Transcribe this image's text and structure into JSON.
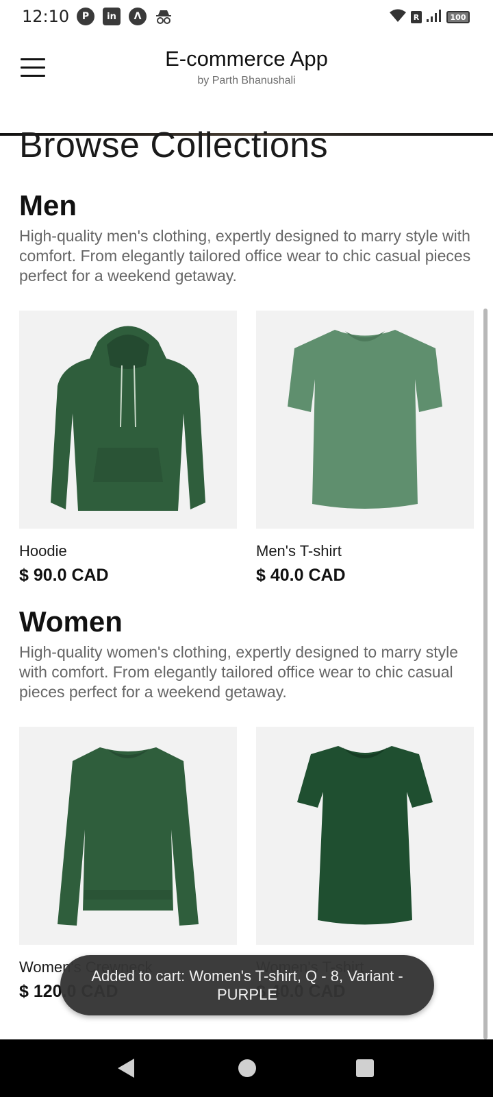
{
  "status_bar": {
    "time": "12:10",
    "notification_icons": [
      "pinterest-icon",
      "linkedin-icon",
      "arch-icon",
      "incognito-icon"
    ],
    "r_badge": "R",
    "battery": "100"
  },
  "app_bar": {
    "title": "E-commerce App",
    "subtitle": "by Parth Bhanushali"
  },
  "page": {
    "title": "Browse Collections"
  },
  "sections": [
    {
      "title": "Men",
      "description": "High-quality men's clothing, expertly designed to marry style with comfort. From elegantly tailored office wear to chic casual pieces perfect for a weekend getaway.",
      "products": [
        {
          "name": "Hoodie",
          "price": "$ 90.0 CAD",
          "image": "green-hoodie"
        },
        {
          "name": "Men's T-shirt",
          "price": "$ 40.0 CAD",
          "image": "green-mens-tshirt"
        }
      ]
    },
    {
      "title": "Women",
      "description": "High-quality women's clothing, expertly designed to marry style with comfort. From elegantly tailored office wear to chic casual pieces perfect for a weekend getaway.",
      "products": [
        {
          "name": "Women's Crewneck",
          "price": "$ 120.0 CAD",
          "image": "green-crewneck"
        },
        {
          "name": "Women's T-shirt",
          "price": "$ 40.0 CAD",
          "image": "green-womens-tshirt"
        }
      ]
    }
  ],
  "toast": {
    "message": "Added to cart:  Women's T-shirt, Q - 8, Variant - PURPLE"
  },
  "colors": {
    "product_green": "#2f5e3c",
    "tshirt_green": "#5f8f6e",
    "toast_bg": "#343434"
  }
}
